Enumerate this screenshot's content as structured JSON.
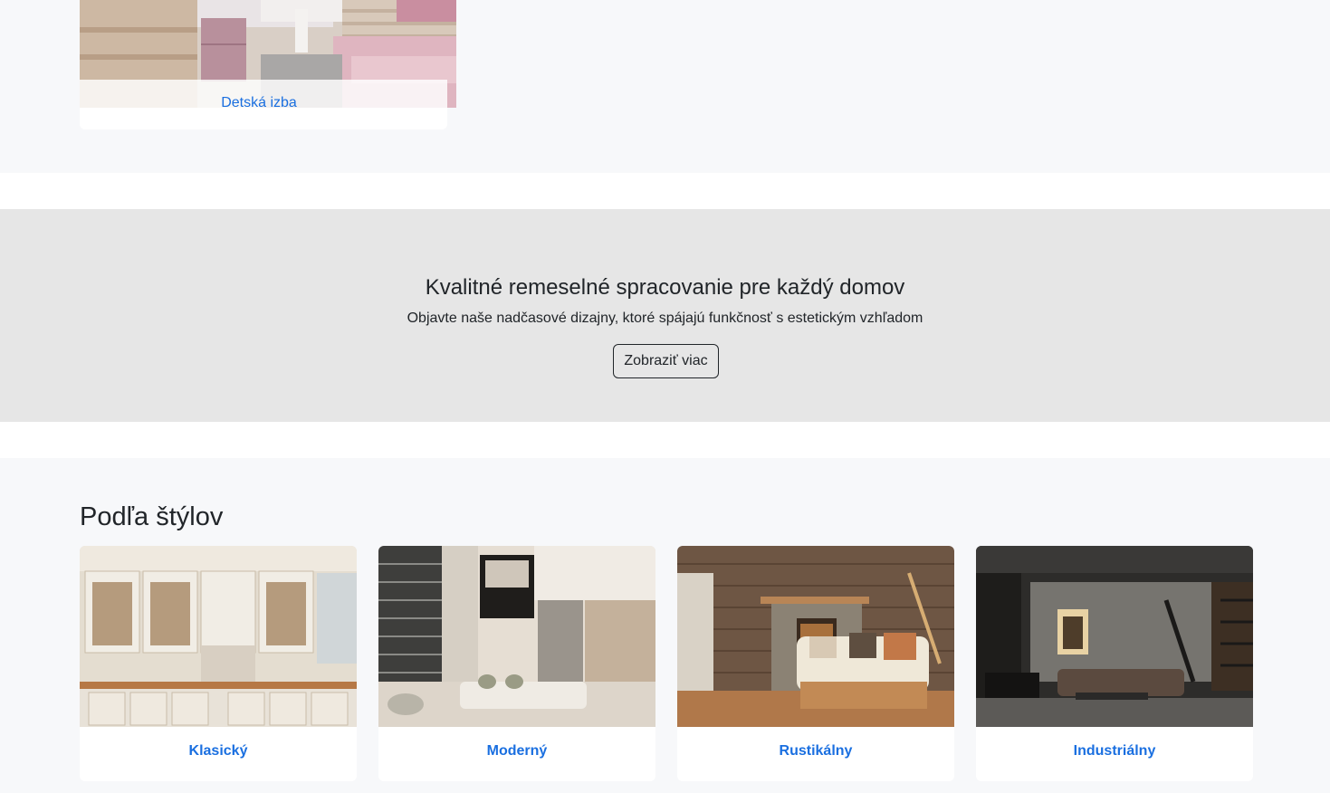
{
  "top_card": {
    "label": "Detská izba"
  },
  "cta": {
    "title": "Kvalitné remeselné spracovanie pre každý domov",
    "subtitle": "Objavte naše nadčasové dizajny, ktoré spájajú funkčnosť s estetickým vzhľadom",
    "button_label": "Zobraziť viac"
  },
  "styles": {
    "heading": "Podľa štýlov",
    "items": [
      {
        "label": "Klasický"
      },
      {
        "label": "Moderný"
      },
      {
        "label": "Rustikálny"
      },
      {
        "label": "Industriálny"
      }
    ]
  },
  "colors": {
    "link": "#1a6fe0",
    "cta_bg": "#e6e6e6",
    "section_bg": "#f7f8fa"
  }
}
